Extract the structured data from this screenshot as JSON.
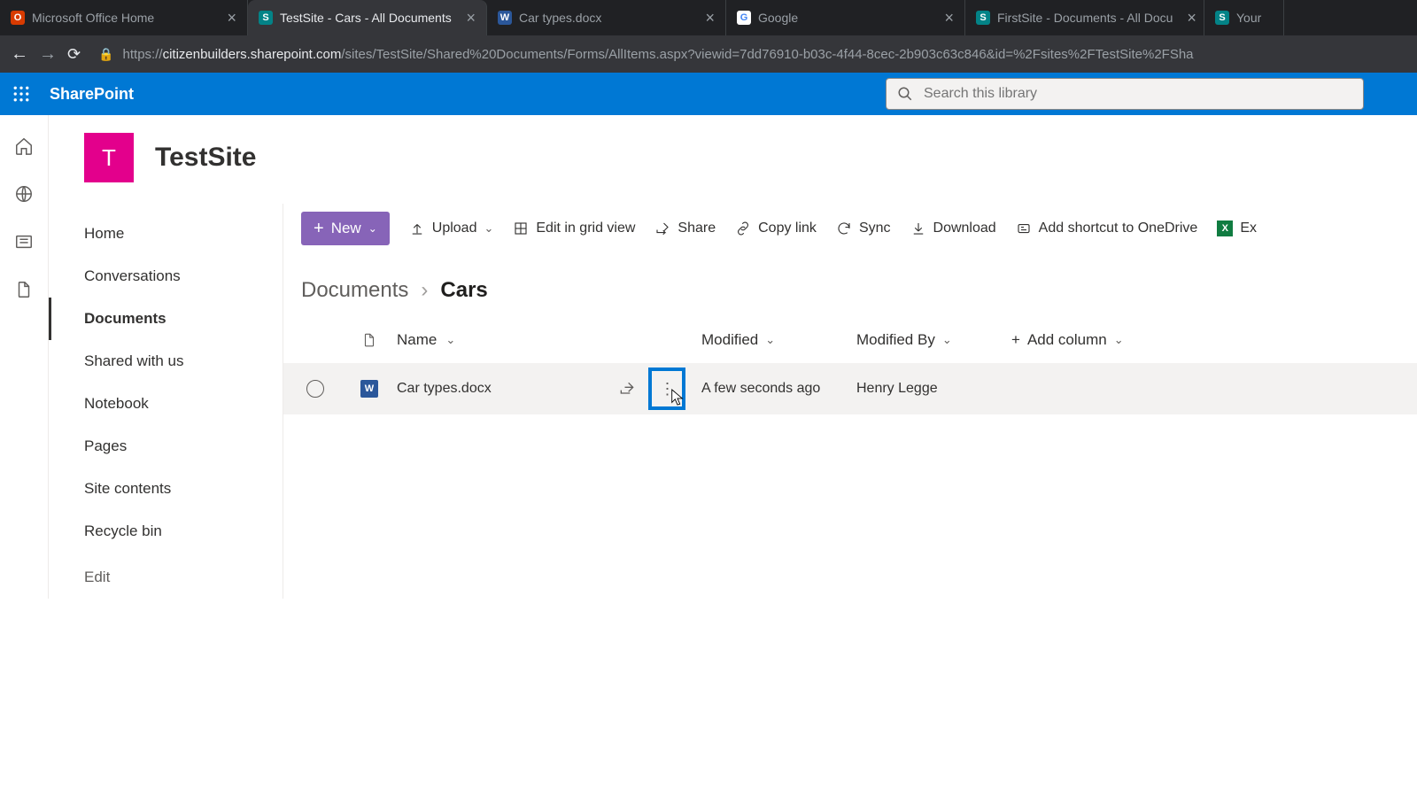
{
  "browser": {
    "tabs": [
      {
        "label": "Microsoft Office Home",
        "favicon_bg": "#d83b01",
        "favicon_text": "O"
      },
      {
        "label": "TestSite - Cars - All Documents",
        "favicon_bg": "#038387",
        "favicon_text": "S",
        "active": true
      },
      {
        "label": "Car types.docx",
        "favicon_bg": "#2b579a",
        "favicon_text": "W"
      },
      {
        "label": "Google",
        "favicon_bg": "#ffffff",
        "favicon_text": "G"
      },
      {
        "label": "FirstSite - Documents - All Docu",
        "favicon_bg": "#038387",
        "favicon_text": "S"
      },
      {
        "label": "Your",
        "favicon_bg": "#038387",
        "favicon_text": "S"
      }
    ],
    "url_host": "citizenbuilders.sharepoint.com",
    "url_path": "/sites/TestSite/Shared%20Documents/Forms/AllItems.aspx?viewid=7dd76910-b03c-4f44-8cec-2b903c63c846&id=%2Fsites%2FTestSite%2FSha"
  },
  "suite": {
    "product": "SharePoint",
    "search_placeholder": "Search this library"
  },
  "site": {
    "logo_letter": "T",
    "title": "TestSite"
  },
  "nav": {
    "items": [
      "Home",
      "Conversations",
      "Documents",
      "Shared with us",
      "Notebook",
      "Pages",
      "Site contents",
      "Recycle bin"
    ],
    "edit": "Edit",
    "selected_index": 2
  },
  "commands": {
    "new": "New",
    "upload": "Upload",
    "edit_grid": "Edit in grid view",
    "share": "Share",
    "copy_link": "Copy link",
    "sync": "Sync",
    "download": "Download",
    "shortcut": "Add shortcut to OneDrive",
    "export": "Ex"
  },
  "breadcrumb": {
    "root": "Documents",
    "leaf": "Cars"
  },
  "columns": {
    "name": "Name",
    "modified": "Modified",
    "modified_by": "Modified By",
    "add": "Add column"
  },
  "files": [
    {
      "name": "Car types.docx",
      "modified": "A few seconds ago",
      "modified_by": "Henry Legge"
    }
  ]
}
